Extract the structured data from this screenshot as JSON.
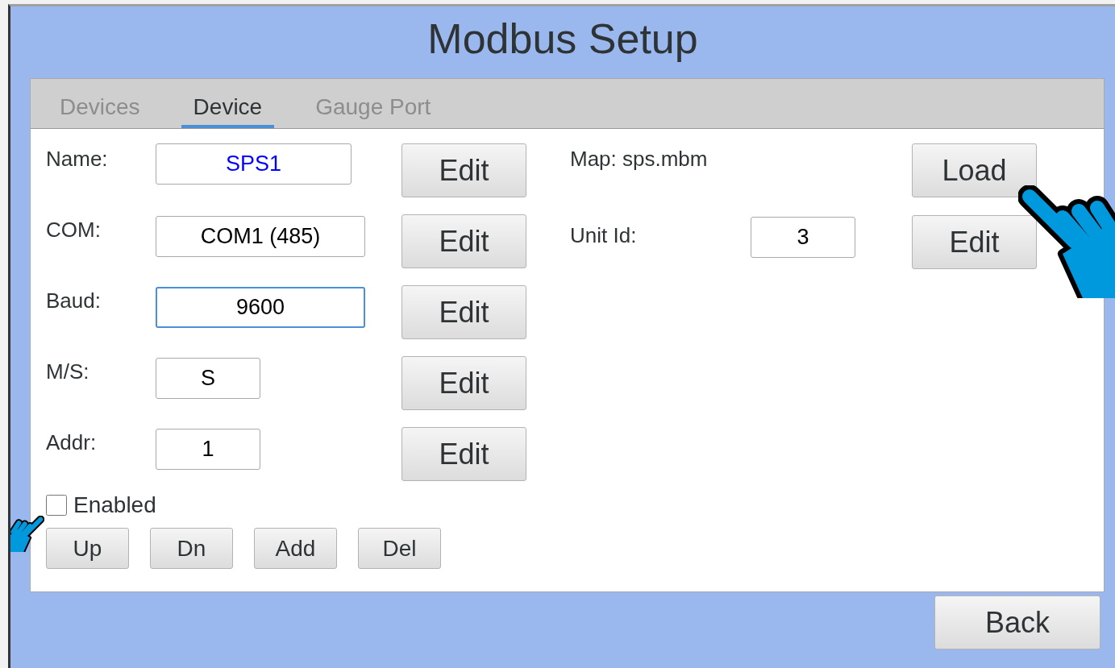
{
  "window": {
    "title": "Modbus Setup"
  },
  "tabs": [
    {
      "label": "Devices",
      "selected": false
    },
    {
      "label": "Device",
      "selected": true
    },
    {
      "label": "Gauge Port",
      "selected": false
    }
  ],
  "fields": [
    {
      "label": "Name:",
      "value": "SPS1",
      "color": "#0000ff",
      "focused": false,
      "button": "Edit"
    },
    {
      "label": "COM:",
      "value": "COM1 (485)",
      "color": "#000000",
      "focused": false,
      "button": "Edit"
    },
    {
      "label": "Baud:",
      "value": "9600",
      "color": "#000000",
      "focused": true,
      "button": "Edit"
    },
    {
      "label": "M/S:",
      "value": "S",
      "color": "#000000",
      "focused": false,
      "button": "Edit"
    },
    {
      "label": "Addr:",
      "value": "1",
      "color": "#000000",
      "focused": false,
      "button": "Edit"
    }
  ],
  "map": {
    "label": "Map: sps.mbm",
    "button": "Load"
  },
  "unit_id": {
    "label": "Unit Id:",
    "value": "3",
    "button": "Edit"
  },
  "enabled": {
    "label": "Enabled",
    "checked": false
  },
  "list_buttons": [
    "Up",
    "Dn",
    "Add",
    "Del"
  ],
  "back_button": "Back"
}
